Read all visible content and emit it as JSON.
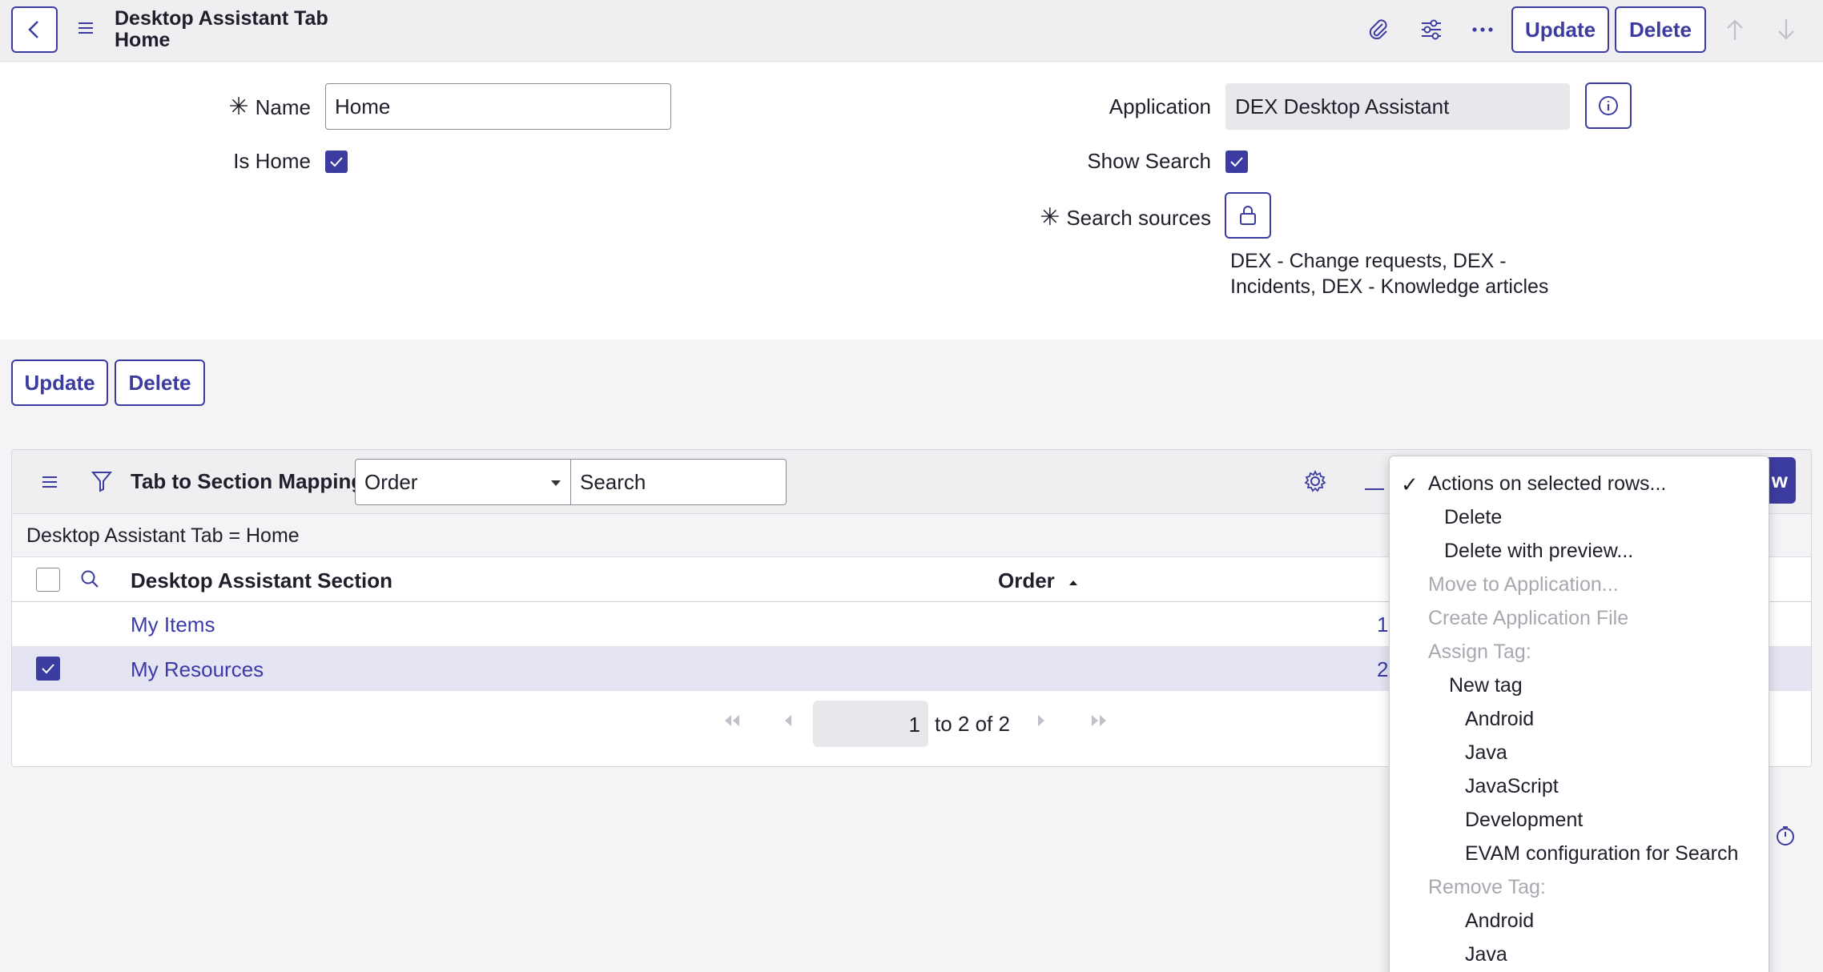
{
  "header": {
    "title_line1": "Desktop Assistant Tab",
    "title_line2": "Home",
    "update_label": "Update",
    "delete_label": "Delete"
  },
  "form": {
    "name_label": "Name",
    "name_value": "Home",
    "is_home_label": "Is Home",
    "is_home_checked": true,
    "application_label": "Application",
    "application_value": "DEX Desktop Assistant",
    "show_search_label": "Show Search",
    "show_search_checked": true,
    "search_sources_label": "Search sources",
    "search_sources_value": "DEX - Change requests, DEX - Incidents, DEX - Knowledge articles",
    "required_mark": "✳"
  },
  "actions": {
    "update_label": "Update",
    "delete_label": "Delete"
  },
  "related_list": {
    "title": "Tab to Section Mappings",
    "sort_select": "Order",
    "search_placeholder": "Search",
    "filter_text": "Desktop Assistant Tab = Home",
    "new_label": "w",
    "columns": [
      "Desktop Assistant Section",
      "Order"
    ],
    "rows": [
      {
        "section": "My Items",
        "order": "1",
        "selected": false
      },
      {
        "section": "My Resources",
        "order": "2",
        "selected": true
      }
    ],
    "pager": {
      "current_page": "1",
      "range_text": "to 2 of 2"
    }
  },
  "dropdown": {
    "items": [
      {
        "label": "Actions on selected rows...",
        "checked": true,
        "disabled": false,
        "indent": 0
      },
      {
        "label": "Delete",
        "disabled": false,
        "indent": 1
      },
      {
        "label": "Delete with preview...",
        "disabled": false,
        "indent": 1
      },
      {
        "label": "Move to Application...",
        "disabled": true,
        "indent": 0
      },
      {
        "label": "Create Application File",
        "disabled": true,
        "indent": 0
      },
      {
        "label": "Assign Tag:",
        "disabled": true,
        "indent": 0
      },
      {
        "label": "New tag",
        "disabled": false,
        "indent": 2
      },
      {
        "label": "Android",
        "disabled": false,
        "indent": 3
      },
      {
        "label": "Java",
        "disabled": false,
        "indent": 3
      },
      {
        "label": "JavaScript",
        "disabled": false,
        "indent": 3
      },
      {
        "label": "Development",
        "disabled": false,
        "indent": 3
      },
      {
        "label": "EVAM configuration for Search",
        "disabled": false,
        "indent": 3
      },
      {
        "label": "Remove Tag:",
        "disabled": true,
        "indent": 0
      },
      {
        "label": "Android",
        "disabled": false,
        "indent": 3
      },
      {
        "label": "Java",
        "disabled": false,
        "indent": 3
      }
    ]
  },
  "colors": {
    "accent": "#3c3ca0",
    "link": "#3a3aa8",
    "disabled": "#a8a8b0",
    "header_bg": "#efeff2",
    "selected_row": "#e4e4f2"
  },
  "icons": [
    "back-icon",
    "menu-icon",
    "attachment-icon",
    "settings-sliders-icon",
    "more-icon",
    "arrow-up-icon",
    "arrow-down-icon",
    "info-icon",
    "lock-icon",
    "filter-icon",
    "gear-icon",
    "minus-icon",
    "search-icon",
    "sort-asc-icon",
    "first-page-icon",
    "prev-page-icon",
    "next-page-icon",
    "last-page-icon",
    "timer-icon",
    "check-icon"
  ]
}
